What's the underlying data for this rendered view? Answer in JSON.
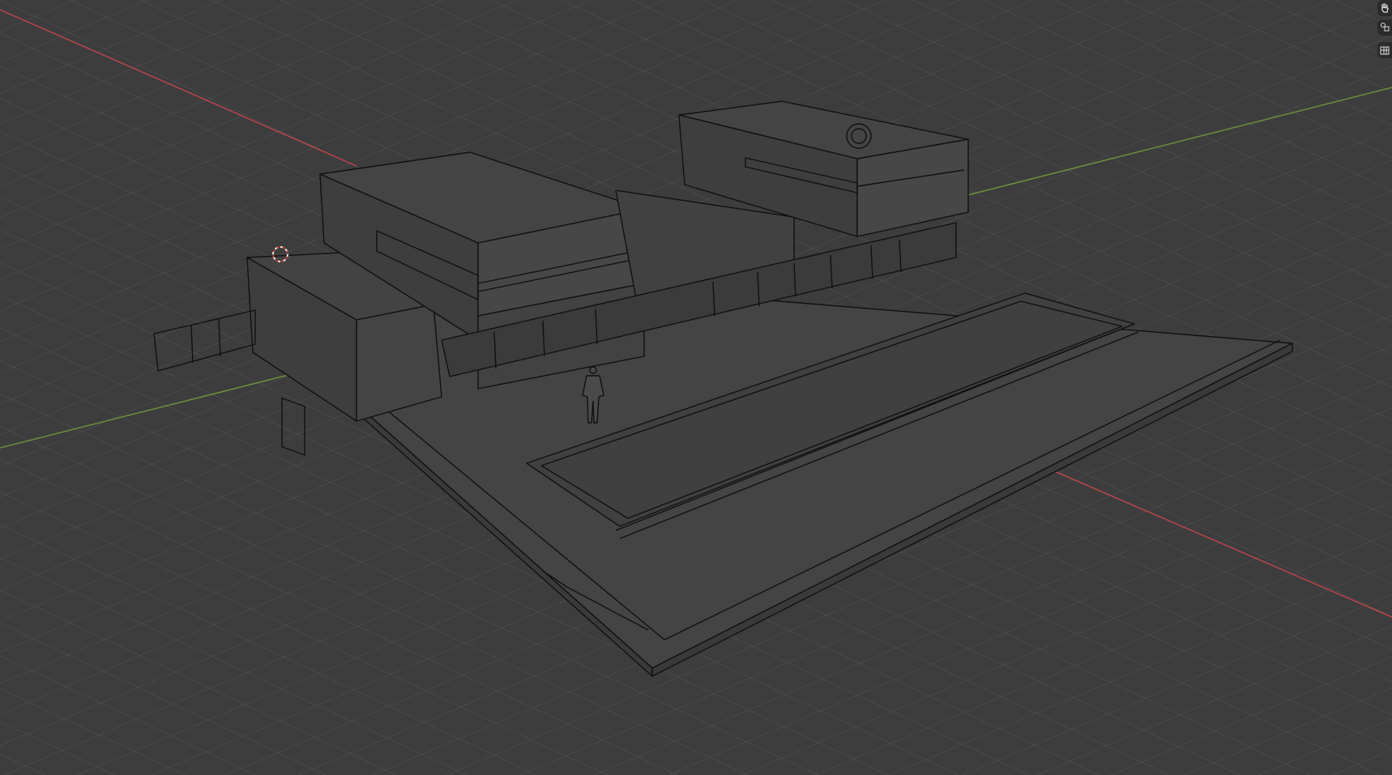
{
  "viewport": {
    "shading": "wireframe",
    "background_color": "#3d3d3d",
    "grid_color": "#545454",
    "x_axis_color": "#b8464c",
    "y_axis_color": "#6d8f3d",
    "wire_color": "#111111",
    "fill_color": "#474747"
  },
  "toolbar": {
    "items": [
      {
        "name": "hand-pan-icon"
      },
      {
        "name": "collections-icon"
      },
      {
        "name": "orthographic-grid-icon"
      }
    ]
  },
  "cursor_3d": {
    "name": "3d-cursor-icon"
  }
}
